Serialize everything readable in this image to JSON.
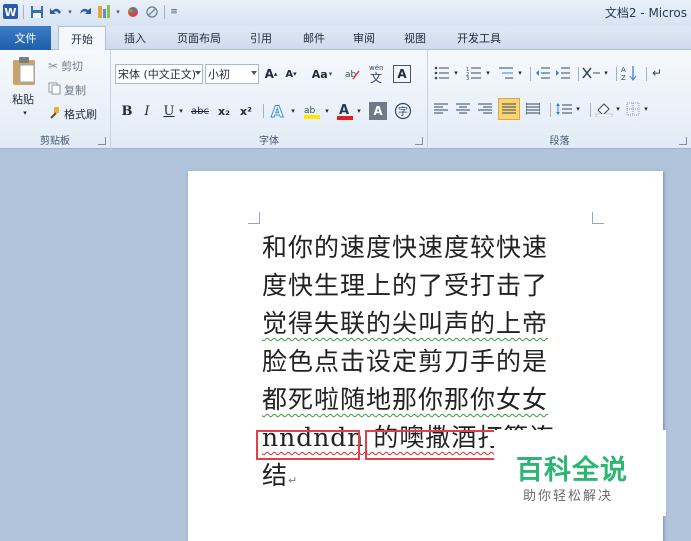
{
  "window": {
    "title": "文档2 - Micros"
  },
  "tabs": {
    "file": "文件",
    "items": [
      "开始",
      "插入",
      "页面布局",
      "引用",
      "邮件",
      "审阅",
      "视图",
      "开发工具"
    ]
  },
  "clipboard": {
    "paste": "粘贴",
    "cut": "剪切",
    "copy": "复制",
    "format_painter": "格式刷",
    "group_label": "剪贴板"
  },
  "font": {
    "family": "宋体 (中文正文)",
    "size": "小初",
    "grow": "A",
    "shrink": "A",
    "change_case": "Aa",
    "bold": "B",
    "italic": "I",
    "underline": "U",
    "strike": "abc",
    "subscript": "x₂",
    "superscript": "x²",
    "group_label": "字体"
  },
  "paragraph": {
    "group_label": "段落"
  },
  "document": {
    "lines": [
      "和你的速度快速度较快速",
      "度快生理上的了受打击了",
      "觉得失联的尖叫声的上帝",
      "脸色点击设定剪刀手的是",
      "都死啦随地那你那你女女",
      "nndndn 的噢撒酒打算连",
      "结"
    ]
  },
  "watermark": {
    "title": "百科全说",
    "subtitle": "助你轻松解决"
  },
  "colors": {
    "ribbon_accent": "#1f5ea8",
    "highlight_box": "#e0404a",
    "watermark_green": "#2cb673",
    "spell_red": "#d03030",
    "grammar_green": "#3a9a3a"
  }
}
